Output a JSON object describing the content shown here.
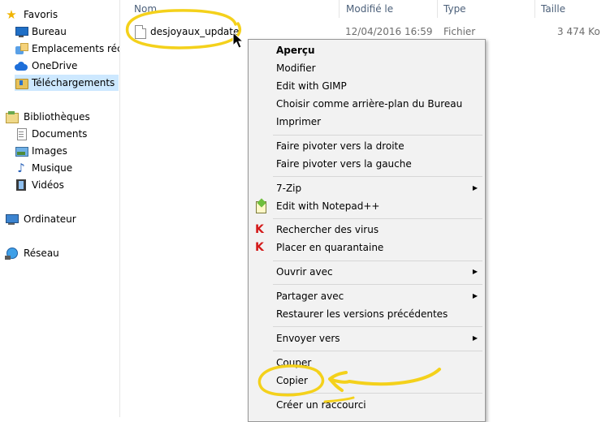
{
  "sidebar": {
    "favorites": {
      "label": "Favoris",
      "icon": "star-icon"
    },
    "items": [
      {
        "label": "Bureau",
        "icon": "desktop-icon"
      },
      {
        "label": "Emplacements récen",
        "icon": "places-icon"
      },
      {
        "label": "OneDrive",
        "icon": "onedrive-icon"
      },
      {
        "label": "Téléchargements",
        "icon": "downloads-folder-icon",
        "selected": true
      }
    ],
    "libraries": {
      "label": "Bibliothèques",
      "icon": "library-icon"
    },
    "library_items": [
      {
        "label": "Documents",
        "icon": "documents-icon"
      },
      {
        "label": "Images",
        "icon": "images-icon"
      },
      {
        "label": "Musique",
        "icon": "music-icon"
      },
      {
        "label": "Vidéos",
        "icon": "videos-icon"
      }
    ],
    "computer": {
      "label": "Ordinateur",
      "icon": "computer-icon"
    },
    "network": {
      "label": "Réseau",
      "icon": "network-icon"
    }
  },
  "columns": {
    "name": "Nom",
    "modified": "Modifié le",
    "type": "Type",
    "size": "Taille"
  },
  "file": {
    "name": "desjoyaux_update",
    "modified": "12/04/2016 16:59",
    "type": "Fichier",
    "size": "3 474 Ko"
  },
  "context_menu": {
    "items": [
      {
        "label": "Aperçu",
        "bold": true
      },
      {
        "label": "Modifier"
      },
      {
        "label": "Edit with GIMP"
      },
      {
        "label": "Choisir comme arrière-plan du Bureau"
      },
      {
        "label": "Imprimer"
      },
      {
        "label": "Faire pivoter vers la droite"
      },
      {
        "label": "Faire pivoter vers la gauche"
      },
      {
        "label": "7-Zip",
        "submenu": true
      },
      {
        "label": "Edit with Notepad++",
        "icon": "notepad-plus-plus-icon"
      },
      {
        "label": "Rechercher des virus",
        "icon": "kaspersky-icon"
      },
      {
        "label": "Placer en quarantaine",
        "icon": "kaspersky-icon"
      },
      {
        "label": "Ouvrir avec",
        "submenu": true
      },
      {
        "label": "Partager avec",
        "submenu": true
      },
      {
        "label": "Restaurer les versions précédentes"
      },
      {
        "label": "Envoyer vers",
        "submenu": true
      },
      {
        "label": "Couper"
      },
      {
        "label": "Copier",
        "highlighted_by_annotation": true
      },
      {
        "label": "Créer un raccourci"
      }
    ]
  },
  "colors": {
    "annotation": "#f4d11b",
    "selection": "#cde8ff",
    "menu_background": "#f2f2f2",
    "header_text": "#4c607a"
  }
}
